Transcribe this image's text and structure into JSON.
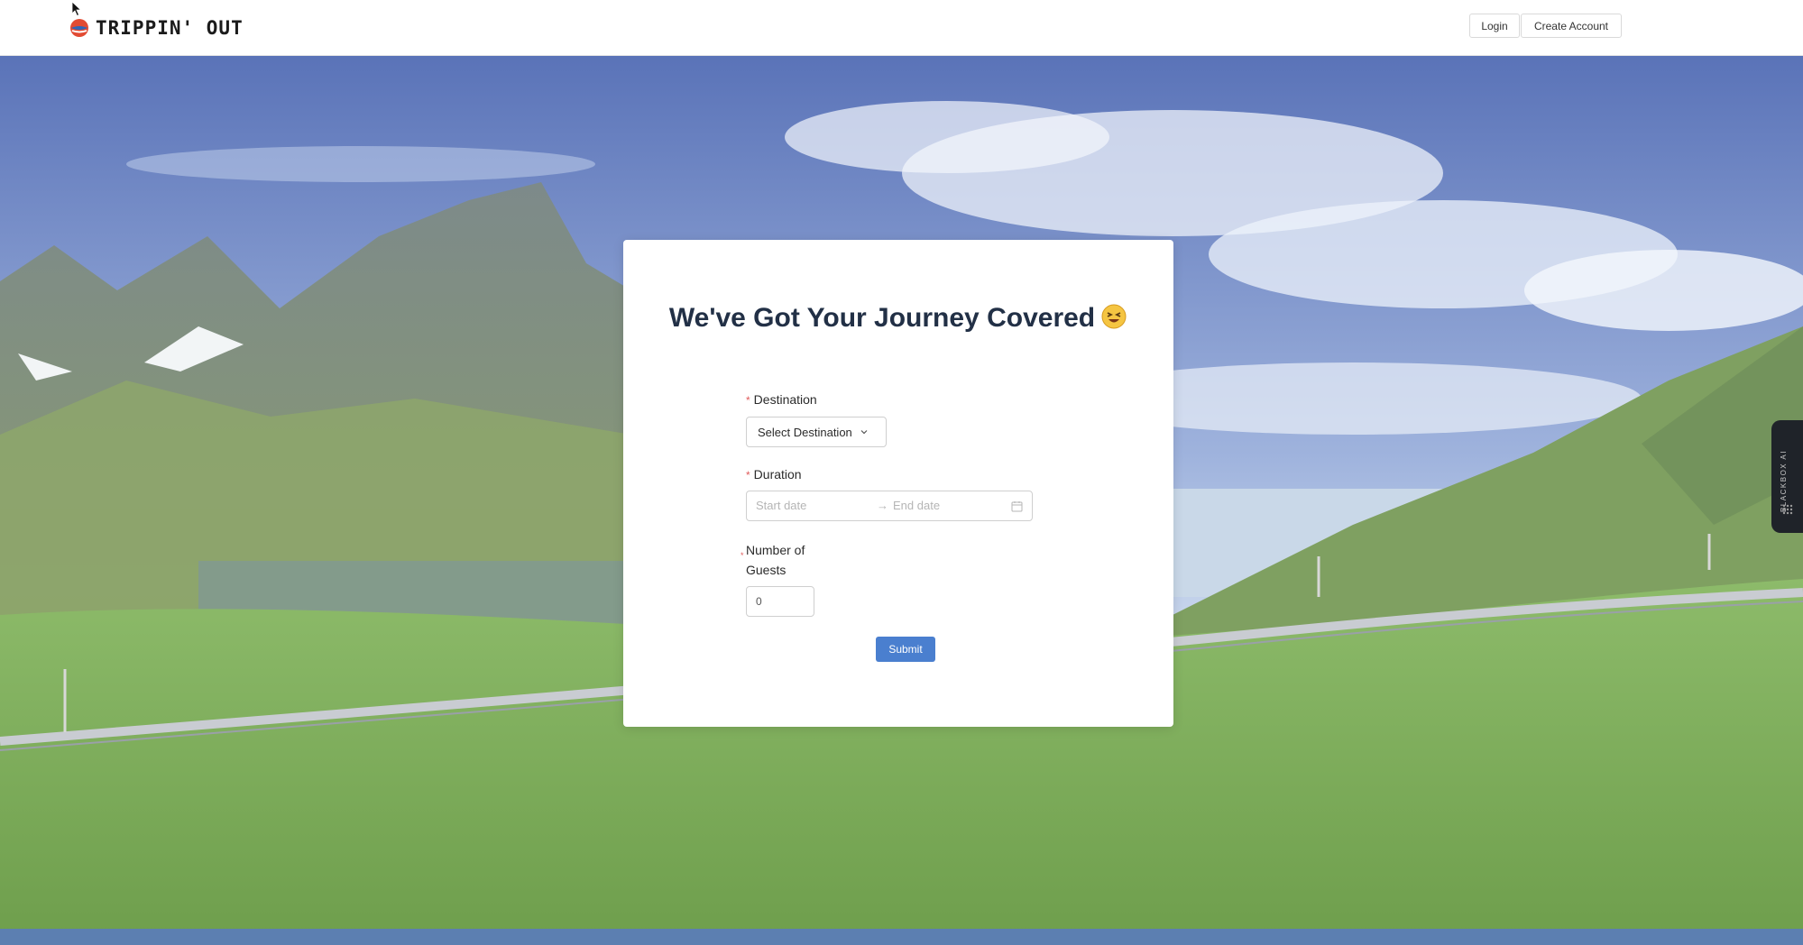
{
  "header": {
    "logo_text": "TRIPPIN' OUT",
    "login_label": "Login",
    "create_account_label": "Create Account"
  },
  "card": {
    "title": "We've Got Your Journey Covered",
    "destination": {
      "required_mark": "*",
      "label": "Destination",
      "select_value": "Select Destination"
    },
    "duration": {
      "required_mark": "*",
      "label": "Duration",
      "start_placeholder": "Start date",
      "arrow": "→",
      "end_placeholder": "End date"
    },
    "guests": {
      "required_mark": "*",
      "label_line1": "Number of",
      "label_line2": "Guests",
      "value": "0"
    },
    "submit_label": "Submit"
  },
  "side_tab": {
    "label": "BLACKBOX AI"
  },
  "colors": {
    "submit": "#4a7fcf",
    "title": "#223046",
    "required": "#e05b5b",
    "side_tab": "#1f2329"
  }
}
